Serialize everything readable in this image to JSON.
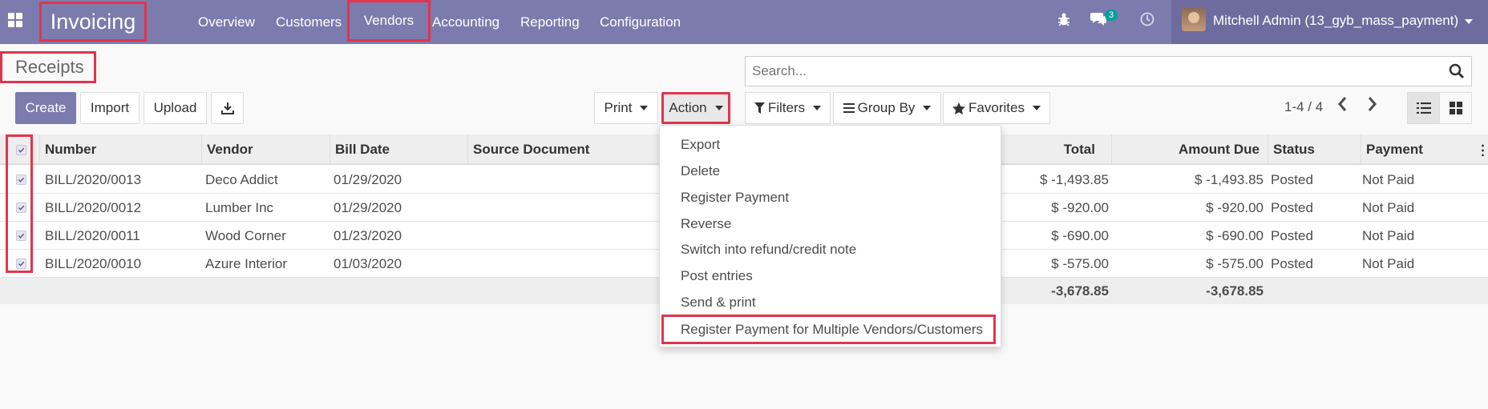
{
  "navbar": {
    "brand": "Invoicing",
    "menu": [
      "Overview",
      "Customers",
      "Vendors",
      "Accounting",
      "Reporting",
      "Configuration"
    ],
    "chat_count": "3",
    "user": "Mitchell Admin (13_gyb_mass_payment)"
  },
  "page": {
    "title": "Receipts",
    "search_placeholder": "Search..."
  },
  "toolbar": {
    "create": "Create",
    "import": "Import",
    "upload": "Upload",
    "print": "Print",
    "action": "Action",
    "filters": "Filters",
    "group_by": "Group By",
    "favorites": "Favorites",
    "pager": "1-4 / 4"
  },
  "table": {
    "columns": [
      "Number",
      "Vendor",
      "Bill Date",
      "Source Document",
      "Total",
      "Amount Due",
      "Status",
      "Payment"
    ],
    "rows": [
      {
        "number": "BILL/2020/0013",
        "vendor": "Deco Addict",
        "bill_date": "01/29/2020",
        "source": "",
        "total": "$ -1,493.85",
        "amount_due": "$ -1,493.85",
        "status": "Posted",
        "payment": "Not Paid"
      },
      {
        "number": "BILL/2020/0012",
        "vendor": "Lumber Inc",
        "bill_date": "01/29/2020",
        "source": "",
        "total": "$ -920.00",
        "amount_due": "$ -920.00",
        "status": "Posted",
        "payment": "Not Paid"
      },
      {
        "number": "BILL/2020/0011",
        "vendor": "Wood Corner",
        "bill_date": "01/23/2020",
        "source": "",
        "total": "$ -690.00",
        "amount_due": "$ -690.00",
        "status": "Posted",
        "payment": "Not Paid"
      },
      {
        "number": "BILL/2020/0010",
        "vendor": "Azure Interior",
        "bill_date": "01/03/2020",
        "source": "",
        "total": "$ -575.00",
        "amount_due": "$ -575.00",
        "status": "Posted",
        "payment": "Not Paid"
      }
    ],
    "footer": {
      "total": "-3,678.85",
      "amount_due": "-3,678.85"
    }
  },
  "action_menu": {
    "items": [
      "Export",
      "Delete",
      "Register Payment",
      "Reverse",
      "Switch into refund/credit note",
      "Post entries",
      "Send & print",
      "Register Payment for Multiple Vendors/Customers"
    ]
  },
  "colors": {
    "navbar": "#7c7bad",
    "highlight": "#e2344c",
    "badge": "#00a09d"
  }
}
